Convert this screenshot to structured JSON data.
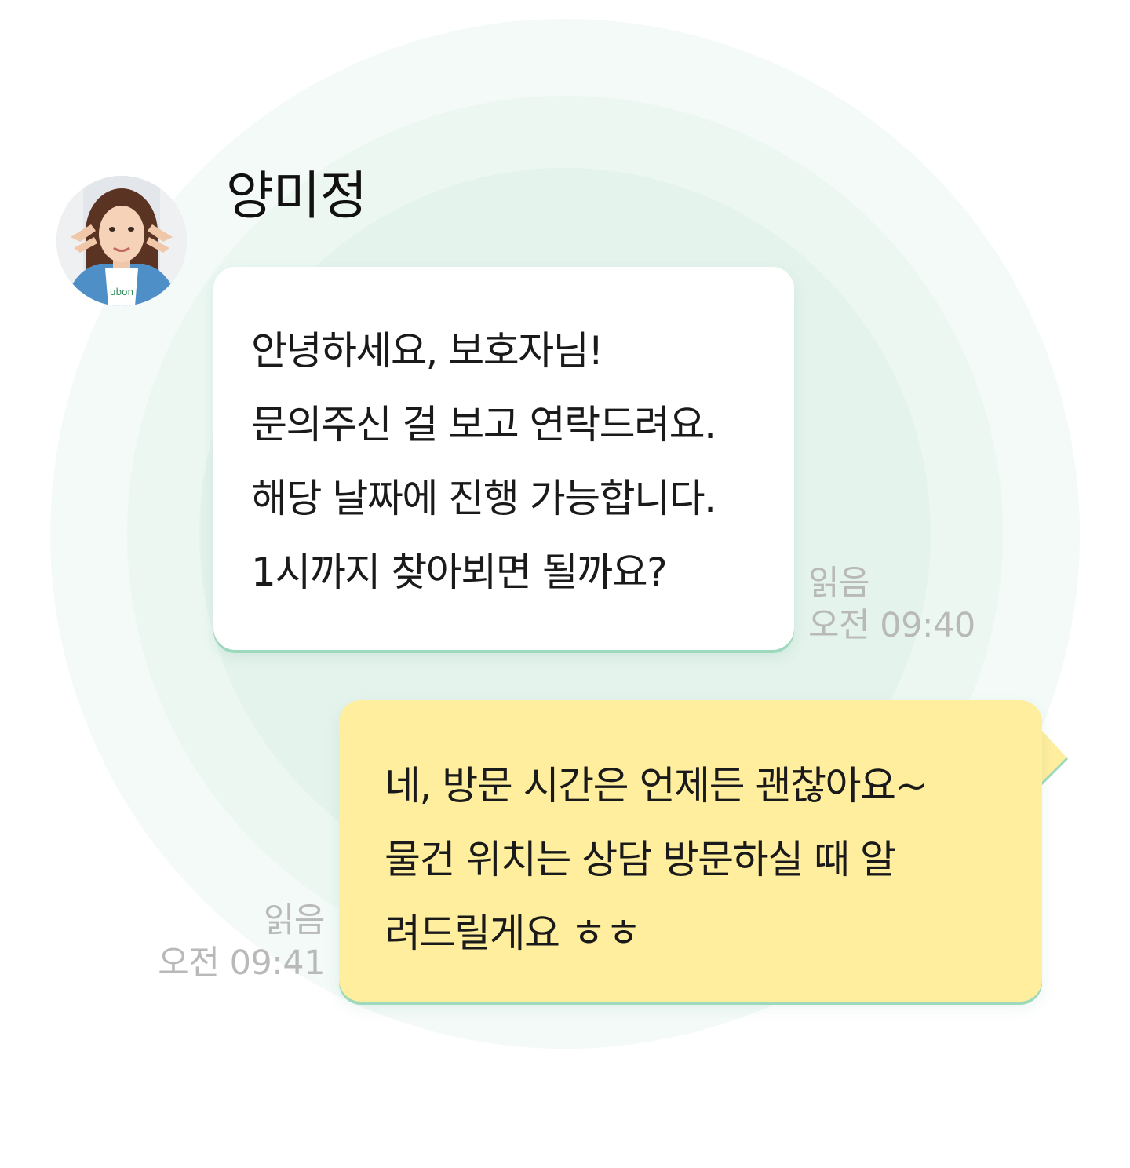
{
  "chat": {
    "incoming": {
      "sender_name": "양미정",
      "avatar": "profile-photo",
      "lines": [
        "안녕하세요, 보호자님!",
        "문의주신 걸 보고 연락드려요.",
        "해당 날짜에 진행 가능합니다.",
        "1시까지 찾아뵈면 될까요?"
      ],
      "read_status": "읽음",
      "time": "오전 09:40"
    },
    "outgoing": {
      "lines": [
        "네, 방문 시간은 언제든 괜찮아요~",
        "물건 위치는 상담 방문하실 때 알",
        "려드릴게요 ㅎㅎ"
      ],
      "read_status": "읽음",
      "time": "오전 09:41"
    }
  },
  "colors": {
    "incoming_bubble": "#ffffff",
    "outgoing_bubble": "#ffee9e",
    "bubble_shadow": "#9dd9bd",
    "meta_text": "#b9b9b9",
    "background_ring": "#e4f3ec"
  }
}
